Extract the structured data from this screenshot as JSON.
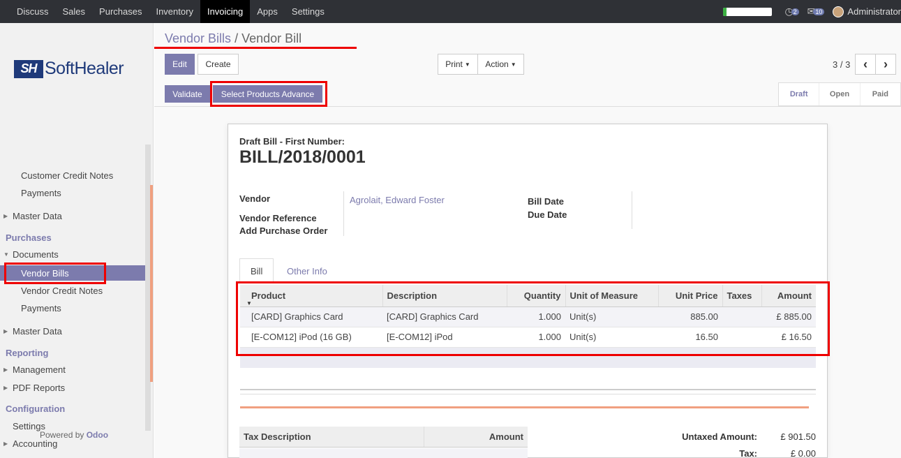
{
  "topbar": {
    "menu": [
      "Discuss",
      "Sales",
      "Purchases",
      "Inventory",
      "Invoicing",
      "Apps",
      "Settings"
    ],
    "active": "Invoicing",
    "progress_fraction": 0.06,
    "activity_count": "2",
    "messages_count": "10",
    "user": "Administrator"
  },
  "sidebar": {
    "logo_mark": "SH",
    "logo_text": "SoftHealer",
    "items": {
      "customer_credit_notes": "Customer Credit Notes",
      "payments_1": "Payments",
      "master_data_1": "Master Data",
      "purchases_head": "Purchases",
      "documents": "Documents",
      "vendor_bills": "Vendor Bills",
      "vendor_credit_notes": "Vendor Credit Notes",
      "payments_2": "Payments",
      "master_data_2": "Master Data",
      "reporting_head": "Reporting",
      "management": "Management",
      "pdf_reports": "PDF Reports",
      "configuration_head": "Configuration",
      "settings": "Settings",
      "accounting": "Accounting"
    },
    "footer_prefix": "Powered by",
    "footer_brand": "Odoo"
  },
  "breadcrumb": {
    "parent": "Vendor Bills",
    "separator": "/",
    "current": "Vendor Bill"
  },
  "buttons": {
    "edit": "Edit",
    "create": "Create",
    "print": "Print",
    "action": "Action",
    "validate": "Validate",
    "select_products": "Select Products Advance"
  },
  "pager": {
    "value": "3 / 3",
    "prev": "‹",
    "next": "›"
  },
  "status": {
    "draft": "Draft",
    "open": "Open",
    "paid": "Paid"
  },
  "form": {
    "subtitle": "Draft Bill - First Number:",
    "title": "BILL/2018/0001",
    "vendor_label": "Vendor",
    "vendor_value": "Agrolait, Edward Foster",
    "vendor_ref_label": "Vendor Reference",
    "add_po_label": "Add Purchase Order",
    "bill_date_label": "Bill Date",
    "due_date_label": "Due Date"
  },
  "tabs": {
    "bill": "Bill",
    "other": "Other Info"
  },
  "lines": {
    "headers": [
      "Product",
      "Description",
      "Quantity",
      "Unit of Measure",
      "Unit Price",
      "Taxes",
      "Amount"
    ],
    "rows": [
      [
        "[CARD] Graphics Card",
        "[CARD] Graphics Card",
        "1.000",
        "Unit(s)",
        "885.00",
        "",
        "£ 885.00"
      ],
      [
        "[E-COM12] iPod (16 GB)",
        "[E-COM12] iPod",
        "1.000",
        "Unit(s)",
        "16.50",
        "",
        "£ 16.50"
      ]
    ]
  },
  "tax_table": {
    "col1": "Tax Description",
    "col2": "Amount"
  },
  "totals": {
    "untaxed_label": "Untaxed Amount:",
    "untaxed_value": "£ 901.50",
    "tax_label": "Tax:",
    "tax_value": "£ 0.00"
  },
  "colors": {
    "accent": "#7c7bad",
    "annotation": "#ee0000",
    "topbar": "#2f3136"
  }
}
